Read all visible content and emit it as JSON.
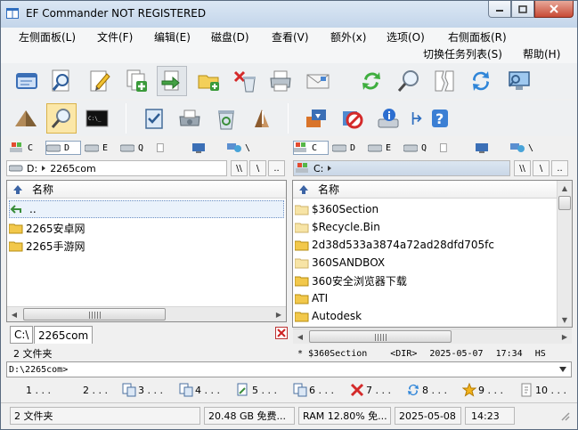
{
  "window": {
    "title": "EF Commander NOT REGISTERED",
    "minimize_icon": "minimize-icon",
    "maximize_icon": "maximize-icon",
    "close_icon": "close-icon"
  },
  "menu": {
    "row1": [
      "左侧面板(L)",
      "文件(F)",
      "编辑(E)",
      "磁盘(D)",
      "查看(V)",
      "额外(x)",
      "选项(O)",
      "右侧面板(R)"
    ],
    "row2": [
      "切换任务列表(S)",
      "帮助(H)"
    ]
  },
  "toolbar1_icons": [
    "window-icon",
    "search-icon",
    "edit-icon",
    "new-file-icon",
    "move-file-icon",
    "move-folder-icon",
    "delete-icon",
    "print-icon",
    "mail-icon",
    "refresh-icon",
    "find-icon",
    "compare-icon",
    "sync-icon",
    "monitor-icon"
  ],
  "toolbar2_icons": [
    "pyramid-icon",
    "find-files-icon",
    "terminal-icon",
    "checklist-icon",
    "printer-icon",
    "recycle-icon",
    "volume-icon",
    "install-icon",
    "no-entry-icon",
    "info-icon",
    "help-icon"
  ],
  "drives_left": [
    "C",
    "D",
    "E",
    "Q",
    "",
    "",
    "\\"
  ],
  "drives_right": [
    "C",
    "D",
    "E",
    "Q",
    "",
    "",
    "\\"
  ],
  "left": {
    "path_drive": "D:",
    "path": "2265com",
    "path_buttons": [
      "\\\\",
      "\\",
      ".."
    ],
    "column_name": "名称",
    "rows": [
      {
        "name": "..",
        "type": "up"
      },
      {
        "name": "2265安卓网",
        "type": "folder"
      },
      {
        "name": "2265手游网",
        "type": "folder"
      }
    ],
    "tabs": [
      "C:\\",
      "2265com"
    ],
    "status": "2 文件夹"
  },
  "right": {
    "path_drive": "C:",
    "path": "",
    "path_buttons": [
      "\\\\",
      "\\",
      ".."
    ],
    "column_name": "名称",
    "rows": [
      {
        "name": "$360Section",
        "type": "folder-light"
      },
      {
        "name": "$Recycle.Bin",
        "type": "folder-light"
      },
      {
        "name": "2d38d533a3874a72ad28dfd705fc",
        "type": "folder"
      },
      {
        "name": "360SANDBOX",
        "type": "folder-light"
      },
      {
        "name": "360安全浏览器下载",
        "type": "folder"
      },
      {
        "name": "ATI",
        "type": "folder"
      },
      {
        "name": "Autodesk",
        "type": "folder"
      }
    ],
    "status": {
      "star": "*",
      "name": "$360Section",
      "type": "<DIR>",
      "date": "2025-05-07",
      "time": "17:34",
      "attr": "HS"
    }
  },
  "command_line": "D:\\2265com>",
  "function_keys": [
    "1 . . .",
    "2 . . .",
    "3 . . .",
    "4 . . .",
    "5 . . .",
    "6 . . .",
    "7 . . .",
    "8 . . .",
    "9 . . .",
    "10 . . ."
  ],
  "bottom": {
    "folders": "2 文件夹",
    "free": "20.48 GB 免费...",
    "ram": "RAM 12.80% 免...",
    "date": "2025-05-08",
    "time": "14:23"
  }
}
